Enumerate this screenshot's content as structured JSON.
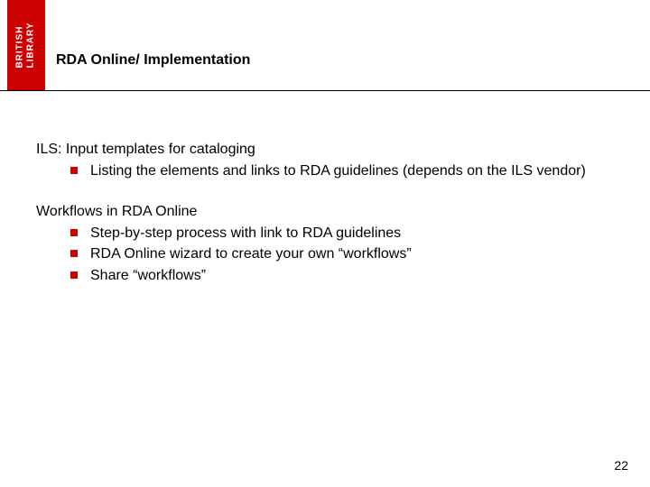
{
  "logo": {
    "line1": "BRITISH",
    "line2": "LIBRARY"
  },
  "title": "RDA Online/ Implementation",
  "sections": [
    {
      "heading": "ILS: Input templates for cataloging",
      "bullets": [
        "Listing the elements and links to RDA guidelines (depends on the ILS vendor)"
      ]
    },
    {
      "heading": "Workflows in RDA Online",
      "bullets": [
        "Step-by-step process with link to RDA guidelines",
        "RDA Online wizard to create your own “workflows”",
        "Share “workflows”"
      ]
    }
  ],
  "page_number": "22"
}
